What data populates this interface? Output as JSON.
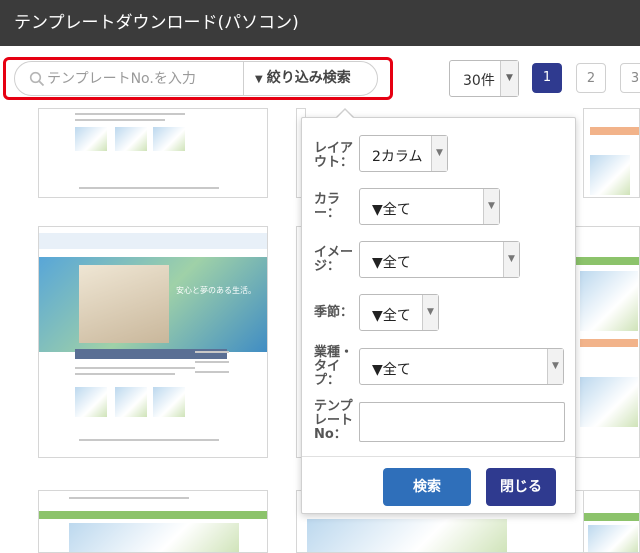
{
  "window": {
    "title": "テンプレートダウンロード(パソコン)"
  },
  "toolbar": {
    "search_placeholder": "テンプレートNo.を入力",
    "filter_label": "絞り込み検索",
    "count_value": "30件",
    "pages": [
      "1",
      "2",
      "3"
    ],
    "active_page": "1",
    "highlight_color": "#e60012"
  },
  "thumbnails": {
    "hero_caption": "安心と夢のある生活。"
  },
  "filter_panel": {
    "fields": [
      {
        "label": "レイアウト：",
        "value": "2カラム"
      },
      {
        "label": "カラー：",
        "value": "▼全て"
      },
      {
        "label": "イメージ：",
        "value": "▼全て"
      },
      {
        "label": "季節：",
        "value": "▼全て"
      },
      {
        "label": "業種・タイプ：",
        "value": "▼全て"
      },
      {
        "label": "テンプレートNo：",
        "value": ""
      }
    ],
    "search_button": "検索",
    "close_button": "閉じる"
  },
  "colors": {
    "title_bar": "#3b3b3b",
    "active_page": "#2f3a8f",
    "search_button": "#2f6fba",
    "close_button": "#2f3a8f"
  }
}
